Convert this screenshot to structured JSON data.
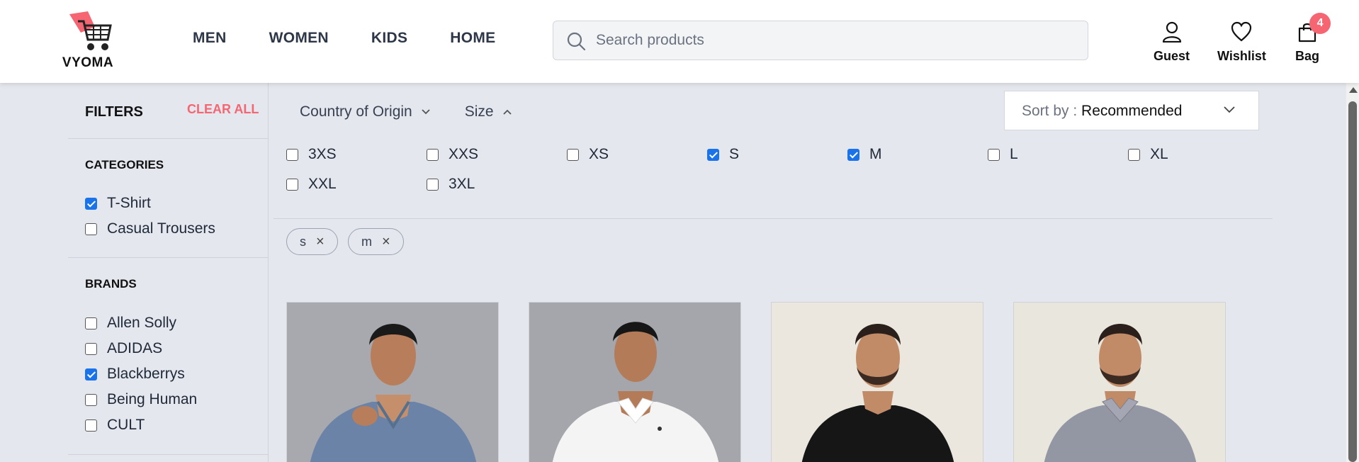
{
  "header": {
    "logo_text": "VYOMA",
    "nav": [
      "MEN",
      "WOMEN",
      "KIDS",
      "HOME"
    ],
    "search_placeholder": "Search products",
    "actions": {
      "guest": "Guest",
      "wishlist": "Wishlist",
      "bag": "Bag",
      "bag_count": "4"
    }
  },
  "sidebar": {
    "title": "FILTERS",
    "clear_all": "CLEAR ALL",
    "categories_title": "CATEGORIES",
    "categories": [
      {
        "label": "T-Shirt",
        "checked": true
      },
      {
        "label": "Casual Trousers",
        "checked": false
      }
    ],
    "brands_title": "BRANDS",
    "brands": [
      {
        "label": "Allen Solly",
        "checked": false
      },
      {
        "label": "ADIDAS",
        "checked": false
      },
      {
        "label": "Blackberrys",
        "checked": true
      },
      {
        "label": "Being Human",
        "checked": false
      },
      {
        "label": "CULT",
        "checked": false
      }
    ]
  },
  "filter_bar": {
    "country": "Country of Origin",
    "size": "Size",
    "sort_prefix": "Sort by : ",
    "sort_value": "Recommended"
  },
  "sizes": [
    {
      "label": "3XS",
      "checked": false
    },
    {
      "label": "XXS",
      "checked": false
    },
    {
      "label": "XS",
      "checked": false
    },
    {
      "label": "S",
      "checked": true
    },
    {
      "label": "M",
      "checked": true
    },
    {
      "label": "L",
      "checked": false
    },
    {
      "label": "XL",
      "checked": false
    },
    {
      "label": "XXL",
      "checked": false
    },
    {
      "label": "3XL",
      "checked": false
    }
  ],
  "chips": [
    "s",
    "m"
  ],
  "colors": {
    "accent": "#f56572",
    "checkbox": "#1a73e8"
  }
}
